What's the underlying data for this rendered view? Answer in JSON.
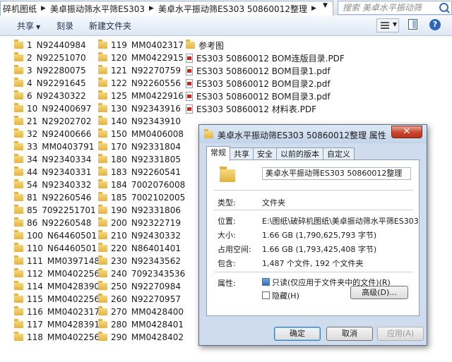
{
  "address": {
    "crumbs": [
      "碎机图纸",
      "美卓振动筛水平筛ES303",
      "美卓水平振动筛ES303  50860012整理"
    ],
    "search_placeholder": "搜索 美卓水平振动筛ES303..."
  },
  "toolbar": {
    "share": "共享",
    "burn": "刻录",
    "new_folder": "新建文件夹"
  },
  "columns": [
    [
      {
        "n": "1",
        "name": "N92440984"
      },
      {
        "n": "2",
        "name": "N92251070"
      },
      {
        "n": "3",
        "name": "N92280075"
      },
      {
        "n": "4",
        "name": "N92291645"
      },
      {
        "n": "6",
        "name": "N92430322"
      },
      {
        "n": "10",
        "name": "N92400697"
      },
      {
        "n": "21",
        "name": "N29202702"
      },
      {
        "n": "32",
        "name": "N92400666"
      },
      {
        "n": "33",
        "name": "MM0403791"
      },
      {
        "n": "34",
        "name": "N92340334"
      },
      {
        "n": "44",
        "name": "N92340331"
      },
      {
        "n": "54",
        "name": "N92340332"
      },
      {
        "n": "81",
        "name": "N92260546"
      },
      {
        "n": "85",
        "name": "7092251701"
      },
      {
        "n": "86",
        "name": "N92260548"
      },
      {
        "n": "100",
        "name": "N64460501"
      },
      {
        "n": "110",
        "name": "N64460501"
      },
      {
        "n": "111",
        "name": "MM0397148"
      },
      {
        "n": "112",
        "name": "MM0402256"
      },
      {
        "n": "114",
        "name": "MM0428390"
      },
      {
        "n": "115",
        "name": "MM0402256"
      },
      {
        "n": "116",
        "name": "MM0402317"
      },
      {
        "n": "117",
        "name": "MM0428391"
      },
      {
        "n": "118",
        "name": "MM0402256"
      }
    ],
    [
      {
        "n": "119",
        "name": "MM0402317"
      },
      {
        "n": "120",
        "name": "MM0422915"
      },
      {
        "n": "121",
        "name": "N92270759"
      },
      {
        "n": "122",
        "name": "N92260556"
      },
      {
        "n": "125",
        "name": "MM0422916"
      },
      {
        "n": "130",
        "name": "N92343916"
      },
      {
        "n": "140",
        "name": "N92343910"
      },
      {
        "n": "150",
        "name": "MM0406008"
      },
      {
        "n": "170",
        "name": "N92331804"
      },
      {
        "n": "180",
        "name": "N92331805"
      },
      {
        "n": "183",
        "name": "N92260541"
      },
      {
        "n": "184",
        "name": "7002076008"
      },
      {
        "n": "185",
        "name": "7002102005"
      },
      {
        "n": "190",
        "name": "N92331806"
      },
      {
        "n": "200",
        "name": "N92322719"
      },
      {
        "n": "210",
        "name": "N92430332"
      },
      {
        "n": "220",
        "name": "N86401401"
      },
      {
        "n": "230",
        "name": "N92343562"
      },
      {
        "n": "240",
        "name": "7092343536"
      },
      {
        "n": "250",
        "name": "N92270984"
      },
      {
        "n": "260",
        "name": "N92270957"
      },
      {
        "n": "270",
        "name": "MM0428400"
      },
      {
        "n": "280",
        "name": "MM0428401"
      },
      {
        "n": "290",
        "name": "MM0428402"
      }
    ]
  ],
  "files": [
    {
      "type": "folder",
      "name": "参考图"
    },
    {
      "type": "pdf",
      "name": "ES303  50860012 BOM连版目录.PDF"
    },
    {
      "type": "pdf",
      "name": "ES303  50860012 BOM目录1.pdf"
    },
    {
      "type": "pdf",
      "name": "ES303  50860012 BOM目录2.pdf"
    },
    {
      "type": "pdf",
      "name": "ES303  50860012 BOM目录3.pdf"
    },
    {
      "type": "pdf",
      "name": "ES303  50860012 材料表.PDF"
    }
  ],
  "dialog": {
    "title": "美卓水平振动筛ES303  50860012整理 属性",
    "close": "✕",
    "tabs": [
      "常规",
      "共享",
      "安全",
      "以前的版本",
      "自定义"
    ],
    "name_value": "美卓水平振动筛ES303  50860012整理",
    "rows": [
      {
        "label": "类型:",
        "value": "文件夹"
      },
      {
        "label": "位置:",
        "value": "E:\\图纸\\破碎机图纸\\美卓振动筛水平筛ES303"
      },
      {
        "label": "大小:",
        "value": "1.66 GB (1,790,625,793 字节)"
      },
      {
        "label": "占用空间:",
        "value": "1.66 GB (1,793,425,408 字节)"
      },
      {
        "label": "包含:",
        "value": "1,487 个文件, 192 个文件夹"
      }
    ],
    "attr_label": "属性:",
    "readonly_label": "只读(仅应用于文件夹中的文件)(R)",
    "hidden_label": "隐藏(H)",
    "advanced": "高级(D)...",
    "ok": "确定",
    "cancel": "取消",
    "apply": "应用(A)"
  }
}
